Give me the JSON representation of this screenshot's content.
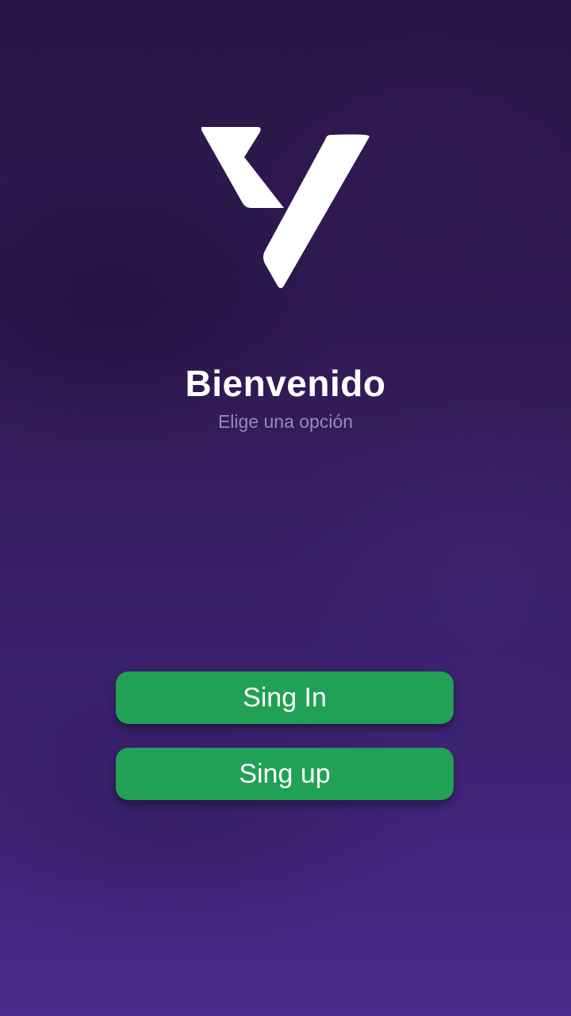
{
  "welcome": {
    "title": "Bienvenido",
    "subtitle": "Elige una opción"
  },
  "actions": {
    "signin_label": "Sing In",
    "signup_label": "Sing up"
  },
  "logo": {
    "icon": "v-logo-icon",
    "color": "#ffffff"
  },
  "colors": {
    "background_top": "#2a1646",
    "background_bottom": "#4a2a8c",
    "button": "#21a155",
    "subtitle": "#9a86b8"
  }
}
